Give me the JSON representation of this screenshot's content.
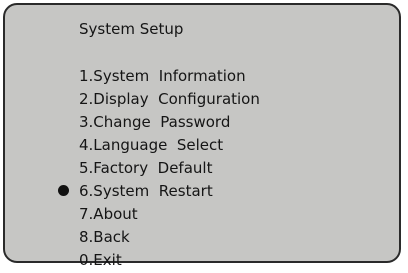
{
  "menu": {
    "title": "System Setup",
    "items": [
      {
        "label": "1.System  Information"
      },
      {
        "label": "2.Display  Configuration"
      },
      {
        "label": "3.Change  Password"
      },
      {
        "label": "4.Language  Select"
      },
      {
        "label": "5.Factory  Default"
      },
      {
        "label": "6.System  Restart",
        "selected": true
      },
      {
        "label": "7.About"
      },
      {
        "label": "8.Back"
      },
      {
        "label": "0.Exit"
      }
    ],
    "selected_index": 5
  },
  "colors": {
    "screen_background": "#c6c6c4",
    "text": "#151515",
    "border": "#2a2a2a"
  }
}
